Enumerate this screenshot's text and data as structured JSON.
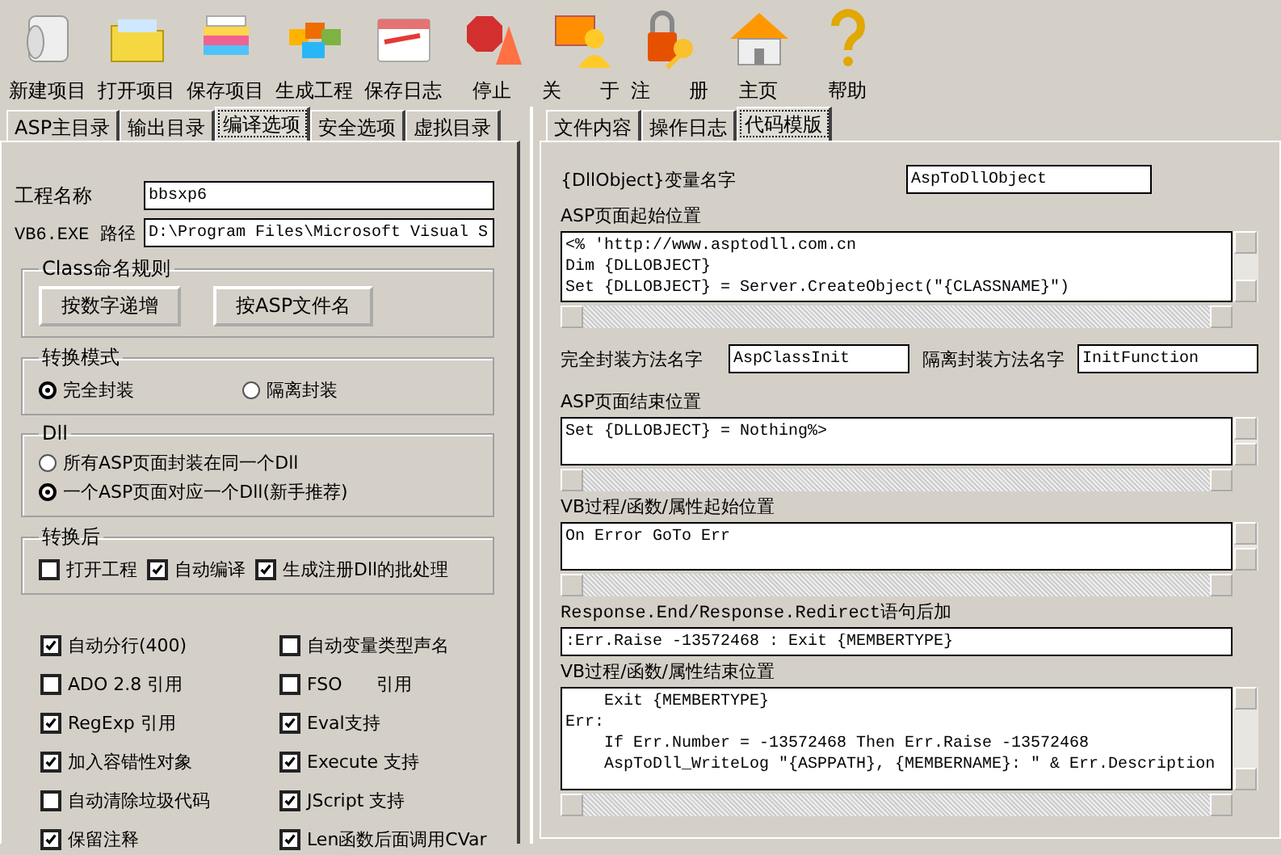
{
  "toolbar": [
    {
      "label": "新建项目"
    },
    {
      "label": "打开项目"
    },
    {
      "label": "保存项目"
    },
    {
      "label": "生成工程"
    },
    {
      "label": "保存日志"
    },
    {
      "label": "停止"
    },
    {
      "label": "关　　于"
    },
    {
      "label": "注　　册"
    },
    {
      "label": "主页"
    },
    {
      "label": "帮助"
    }
  ],
  "left_tabs": [
    {
      "label": "ASP主目录",
      "selected": false
    },
    {
      "label": "输出目录",
      "selected": false
    },
    {
      "label": "编译选项",
      "selected": true
    },
    {
      "label": "安全选项",
      "selected": false
    },
    {
      "label": "虚拟目录",
      "selected": false
    }
  ],
  "right_tabs": [
    {
      "label": "文件内容",
      "selected": false
    },
    {
      "label": "操作日志",
      "selected": false
    },
    {
      "label": "代码模版",
      "selected": true
    }
  ],
  "project": {
    "name_label": "工程名称",
    "name_value": "bbsxp6",
    "path_label": "VB6.EXE 路径",
    "path_value": "D:\\Program Files\\Microsoft Visual S"
  },
  "class_naming": {
    "title": "Class命名规则",
    "buttons": [
      "按数字递增",
      "按ASP文件名"
    ]
  },
  "mode": {
    "title": "转换模式",
    "options": [
      {
        "label": "完全封装",
        "selected": true
      },
      {
        "label": "隔离封装",
        "selected": false
      }
    ]
  },
  "dll": {
    "title": "Dll",
    "options": [
      {
        "label": "所有ASP页面封装在同一个Dll",
        "selected": false
      },
      {
        "label": "一个ASP页面对应一个Dll(新手推荐)",
        "selected": true
      }
    ]
  },
  "after": {
    "title": "转换后",
    "options": [
      {
        "label": "打开工程",
        "checked": false
      },
      {
        "label": "自动编译",
        "checked": true
      },
      {
        "label": "生成注册Dll的批处理",
        "checked": true
      }
    ]
  },
  "options": [
    {
      "label": "自动分行(400)",
      "checked": true
    },
    {
      "label": "自动变量类型声名",
      "checked": false
    },
    {
      "label": "ADO 2.8 引用",
      "checked": false
    },
    {
      "label": "FSO      引用",
      "checked": false
    },
    {
      "label": "RegExp 引用",
      "checked": true
    },
    {
      "label": "Eval支持",
      "checked": true
    },
    {
      "label": "加入容错性对象",
      "checked": true
    },
    {
      "label": "Execute 支持",
      "checked": true
    },
    {
      "label": "自动清除垃圾代码",
      "checked": false
    },
    {
      "label": "JScript 支持",
      "checked": true
    },
    {
      "label": "保留注释",
      "checked": true
    },
    {
      "label": "Len函数后面调用CVar",
      "checked": true
    }
  ],
  "templates": [
    {
      "kind": "inline",
      "label": "{DllObject}变量名字",
      "value": "AspToDllObject"
    },
    {
      "kind": "code",
      "label": "ASP页面起始位置",
      "lines": [
        "<% 'http://www.asptodll.com.cn",
        "Dim {DLLOBJECT}",
        "Set {DLLOBJECT} = Server.CreateObject(\"{CLASSNAME}\")"
      ]
    },
    {
      "kind": "pair",
      "label": "完全封装方法名字",
      "value": "AspClassInit",
      "label2": "隔离封装方法名字",
      "value2": "InitFunction"
    },
    {
      "kind": "code",
      "label": "ASP页面结束位置",
      "lines": [
        "Set {DLLOBJECT} = Nothing%>"
      ]
    },
    {
      "kind": "code",
      "label": "VB过程/函数/属性起始位置",
      "lines": [
        "On Error GoTo Err"
      ]
    },
    {
      "kind": "field",
      "label": "Response.End/Response.Redirect语句后加",
      "value": ":Err.Raise -13572468 : Exit {MEMBERTYPE}"
    },
    {
      "kind": "code",
      "label": "VB过程/函数/属性结束位置",
      "lines": [
        "    Exit {MEMBERTYPE}",
        "Err:",
        "    If Err.Number = -13572468 Then Err.Raise -13572468",
        "    AspToDll_WriteLog \"{ASPPATH}, {MEMBERNAME}: \" & Err.Description"
      ]
    }
  ]
}
